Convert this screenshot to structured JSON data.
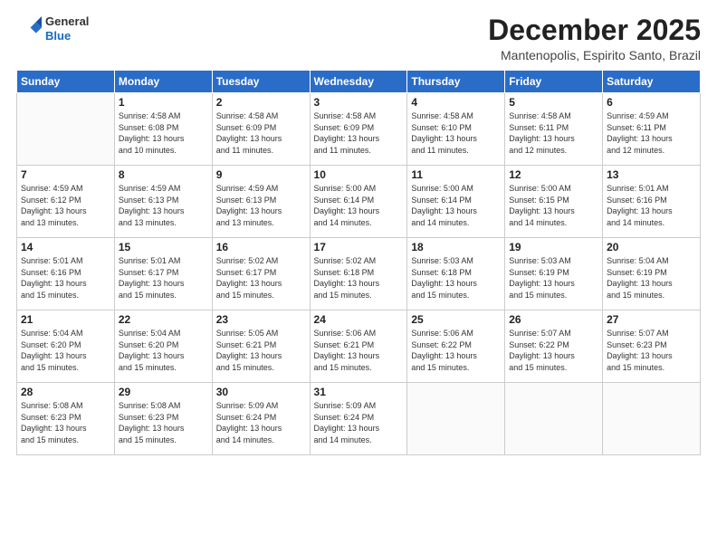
{
  "header": {
    "logo_general": "General",
    "logo_blue": "Blue",
    "month_title": "December 2025",
    "location": "Mantenopolis, Espirito Santo, Brazil"
  },
  "days_of_week": [
    "Sunday",
    "Monday",
    "Tuesday",
    "Wednesday",
    "Thursday",
    "Friday",
    "Saturday"
  ],
  "weeks": [
    [
      {
        "day": "",
        "info": ""
      },
      {
        "day": "1",
        "info": "Sunrise: 4:58 AM\nSunset: 6:08 PM\nDaylight: 13 hours\nand 10 minutes."
      },
      {
        "day": "2",
        "info": "Sunrise: 4:58 AM\nSunset: 6:09 PM\nDaylight: 13 hours\nand 11 minutes."
      },
      {
        "day": "3",
        "info": "Sunrise: 4:58 AM\nSunset: 6:09 PM\nDaylight: 13 hours\nand 11 minutes."
      },
      {
        "day": "4",
        "info": "Sunrise: 4:58 AM\nSunset: 6:10 PM\nDaylight: 13 hours\nand 11 minutes."
      },
      {
        "day": "5",
        "info": "Sunrise: 4:58 AM\nSunset: 6:11 PM\nDaylight: 13 hours\nand 12 minutes."
      },
      {
        "day": "6",
        "info": "Sunrise: 4:59 AM\nSunset: 6:11 PM\nDaylight: 13 hours\nand 12 minutes."
      }
    ],
    [
      {
        "day": "7",
        "info": "Sunrise: 4:59 AM\nSunset: 6:12 PM\nDaylight: 13 hours\nand 13 minutes."
      },
      {
        "day": "8",
        "info": "Sunrise: 4:59 AM\nSunset: 6:13 PM\nDaylight: 13 hours\nand 13 minutes."
      },
      {
        "day": "9",
        "info": "Sunrise: 4:59 AM\nSunset: 6:13 PM\nDaylight: 13 hours\nand 13 minutes."
      },
      {
        "day": "10",
        "info": "Sunrise: 5:00 AM\nSunset: 6:14 PM\nDaylight: 13 hours\nand 14 minutes."
      },
      {
        "day": "11",
        "info": "Sunrise: 5:00 AM\nSunset: 6:14 PM\nDaylight: 13 hours\nand 14 minutes."
      },
      {
        "day": "12",
        "info": "Sunrise: 5:00 AM\nSunset: 6:15 PM\nDaylight: 13 hours\nand 14 minutes."
      },
      {
        "day": "13",
        "info": "Sunrise: 5:01 AM\nSunset: 6:16 PM\nDaylight: 13 hours\nand 14 minutes."
      }
    ],
    [
      {
        "day": "14",
        "info": "Sunrise: 5:01 AM\nSunset: 6:16 PM\nDaylight: 13 hours\nand 15 minutes."
      },
      {
        "day": "15",
        "info": "Sunrise: 5:01 AM\nSunset: 6:17 PM\nDaylight: 13 hours\nand 15 minutes."
      },
      {
        "day": "16",
        "info": "Sunrise: 5:02 AM\nSunset: 6:17 PM\nDaylight: 13 hours\nand 15 minutes."
      },
      {
        "day": "17",
        "info": "Sunrise: 5:02 AM\nSunset: 6:18 PM\nDaylight: 13 hours\nand 15 minutes."
      },
      {
        "day": "18",
        "info": "Sunrise: 5:03 AM\nSunset: 6:18 PM\nDaylight: 13 hours\nand 15 minutes."
      },
      {
        "day": "19",
        "info": "Sunrise: 5:03 AM\nSunset: 6:19 PM\nDaylight: 13 hours\nand 15 minutes."
      },
      {
        "day": "20",
        "info": "Sunrise: 5:04 AM\nSunset: 6:19 PM\nDaylight: 13 hours\nand 15 minutes."
      }
    ],
    [
      {
        "day": "21",
        "info": "Sunrise: 5:04 AM\nSunset: 6:20 PM\nDaylight: 13 hours\nand 15 minutes."
      },
      {
        "day": "22",
        "info": "Sunrise: 5:04 AM\nSunset: 6:20 PM\nDaylight: 13 hours\nand 15 minutes."
      },
      {
        "day": "23",
        "info": "Sunrise: 5:05 AM\nSunset: 6:21 PM\nDaylight: 13 hours\nand 15 minutes."
      },
      {
        "day": "24",
        "info": "Sunrise: 5:06 AM\nSunset: 6:21 PM\nDaylight: 13 hours\nand 15 minutes."
      },
      {
        "day": "25",
        "info": "Sunrise: 5:06 AM\nSunset: 6:22 PM\nDaylight: 13 hours\nand 15 minutes."
      },
      {
        "day": "26",
        "info": "Sunrise: 5:07 AM\nSunset: 6:22 PM\nDaylight: 13 hours\nand 15 minutes."
      },
      {
        "day": "27",
        "info": "Sunrise: 5:07 AM\nSunset: 6:23 PM\nDaylight: 13 hours\nand 15 minutes."
      }
    ],
    [
      {
        "day": "28",
        "info": "Sunrise: 5:08 AM\nSunset: 6:23 PM\nDaylight: 13 hours\nand 15 minutes."
      },
      {
        "day": "29",
        "info": "Sunrise: 5:08 AM\nSunset: 6:23 PM\nDaylight: 13 hours\nand 15 minutes."
      },
      {
        "day": "30",
        "info": "Sunrise: 5:09 AM\nSunset: 6:24 PM\nDaylight: 13 hours\nand 14 minutes."
      },
      {
        "day": "31",
        "info": "Sunrise: 5:09 AM\nSunset: 6:24 PM\nDaylight: 13 hours\nand 14 minutes."
      },
      {
        "day": "",
        "info": ""
      },
      {
        "day": "",
        "info": ""
      },
      {
        "day": "",
        "info": ""
      }
    ]
  ]
}
